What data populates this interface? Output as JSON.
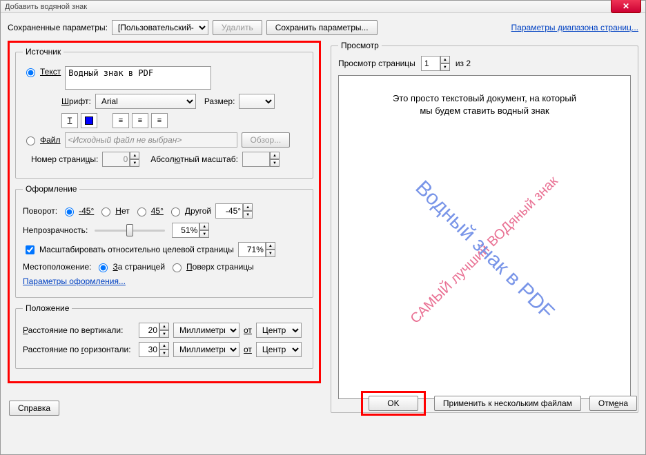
{
  "title": "Добавить водяной знак",
  "top": {
    "saved_label": "Сохраненные параметры:",
    "saved_value": "[Пользовательский-не",
    "delete_btn": "Удалить",
    "save_btn": "Сохранить параметры...",
    "page_range_link": "Параметры диапазона страниц..."
  },
  "source": {
    "legend": "Источник",
    "text_radio": "Текст",
    "text_value": "Водный знак в PDF",
    "font_label": "Шрифт:",
    "font_value": "Arial",
    "size_label": "Размер:",
    "size_value": "",
    "file_radio": "Файл",
    "file_value": "<Исходный файл не выбран>",
    "browse_btn": "Обзор...",
    "page_num_label": "Номер страницы:",
    "page_num_value": "0",
    "abs_scale_label": "Абсолютный масштаб:",
    "abs_scale_value": ""
  },
  "appearance": {
    "legend": "Оформление",
    "rotation_label": "Поворот:",
    "r_m45": "-45°",
    "r_none": "Нет",
    "r_p45": "45°",
    "r_other": "Другой",
    "r_other_value": "-45°",
    "opacity_label": "Непрозрачность:",
    "opacity_value": "51%",
    "scale_checkbox": "Масштабировать относительно целевой страницы",
    "scale_value": "71%",
    "location_label": "Местоположение:",
    "loc_behind": "За страницей",
    "loc_over": "Поверх страницы",
    "appearance_link": "Параметры оформления..."
  },
  "position": {
    "legend": "Положение",
    "v_label": "Расстояние по вертикали:",
    "v_value": "20",
    "h_label": "Расстояние по горизонтали:",
    "h_value": "30",
    "unit": "Миллиметры",
    "from_label": "от",
    "from_value": "Центр"
  },
  "preview": {
    "legend": "Просмотр",
    "page_label": "Просмотр страницы",
    "page_value": "1",
    "of_label": "из 2",
    "doc_line1": "Это просто текстовый документ, на который",
    "doc_line2": "мы будем ставить водный знак",
    "wm_blue": "Водный знак в PDF",
    "wm_pink": "САМЫЙ лучший ВОДяный знак"
  },
  "buttons": {
    "help": "Справка",
    "ok": "OK",
    "apply_multi": "Применить к нескольким файлам",
    "cancel": "Отмена"
  },
  "icons": {
    "underline": "T",
    "align_left": "≡",
    "align_center": "≡",
    "align_right": "≡"
  }
}
